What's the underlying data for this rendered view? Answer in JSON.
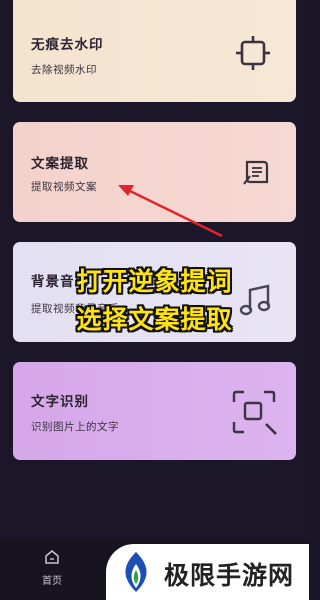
{
  "cards": [
    {
      "title": "无痕去水印",
      "subtitle": "去除视频水印",
      "icon": "crop-frame-icon"
    },
    {
      "title": "文案提取",
      "subtitle": "提取视频文案",
      "icon": "document-pen-icon"
    },
    {
      "title": "背景音乐",
      "subtitle": "提取视频背景音乐",
      "icon": "music-note-icon"
    },
    {
      "title": "文字识别",
      "subtitle": "识别图片上的文字",
      "icon": "scan-search-icon"
    }
  ],
  "overlay": {
    "line1": "打开逆象提词",
    "line2": "选择文案提取",
    "color": "#ffe312"
  },
  "bottom_nav": {
    "home_label": "首页"
  },
  "watermark": {
    "text": "极限手游网"
  }
}
